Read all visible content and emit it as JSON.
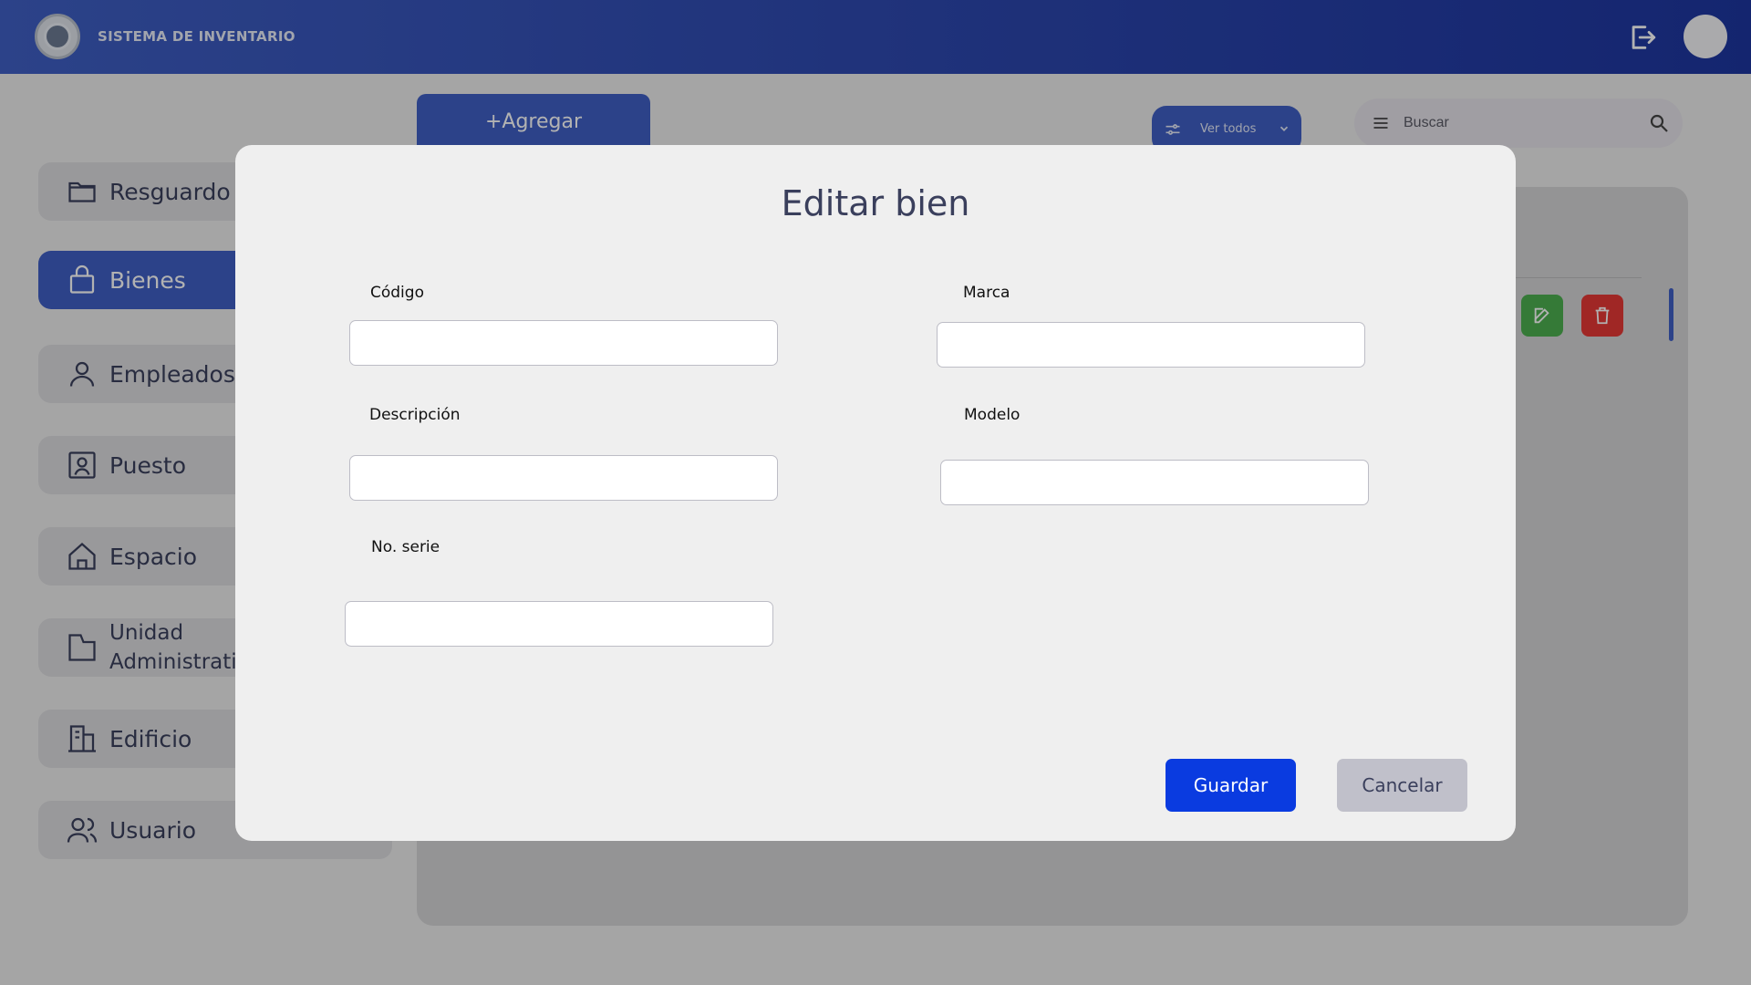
{
  "header": {
    "app_title": "SISTEMA DE INVENTARIO",
    "logo_icon": "institution-seal-icon",
    "logout_icon": "logout-icon",
    "avatar": "user-avatar"
  },
  "sidebar": {
    "items": [
      {
        "label": "Resguardo",
        "icon": "folder-icon",
        "active": false
      },
      {
        "label": "Bienes",
        "icon": "bag-icon",
        "active": true
      },
      {
        "label": "Empleados",
        "icon": "person-icon",
        "active": false
      },
      {
        "label": "Puesto",
        "icon": "id-badge-icon",
        "active": false
      },
      {
        "label": "Espacio",
        "icon": "home-icon",
        "active": false
      },
      {
        "label_line1": "Unidad",
        "label_line2": "Administrati",
        "icon": "document-icon",
        "active": false
      },
      {
        "label": "Edificio",
        "icon": "building-icon",
        "active": false
      },
      {
        "label": "Usuario",
        "icon": "users-icon",
        "active": false
      }
    ],
    "active_color": "#3f5fc4"
  },
  "toolbar": {
    "add_label": "+Agregar",
    "filter_label": "Ver todos",
    "search_placeholder": "Buscar"
  },
  "modal": {
    "title": "Editar bien",
    "fields": {
      "codigo": {
        "label": "Código",
        "value": ""
      },
      "marca": {
        "label": "Marca",
        "value": ""
      },
      "descripcion": {
        "label": "Descripción",
        "value": ""
      },
      "modelo": {
        "label": "Modelo",
        "value": ""
      },
      "no_serie": {
        "label": "No. serie",
        "value": ""
      }
    },
    "save_label": "Guardar",
    "cancel_label": "Cancelar"
  },
  "colors": {
    "primary": "#3f5fc4",
    "save_button": "#0a3be0",
    "cancel_button": "#c0c0ca",
    "edit_action": "#4caf50",
    "delete_action": "#e53935"
  }
}
